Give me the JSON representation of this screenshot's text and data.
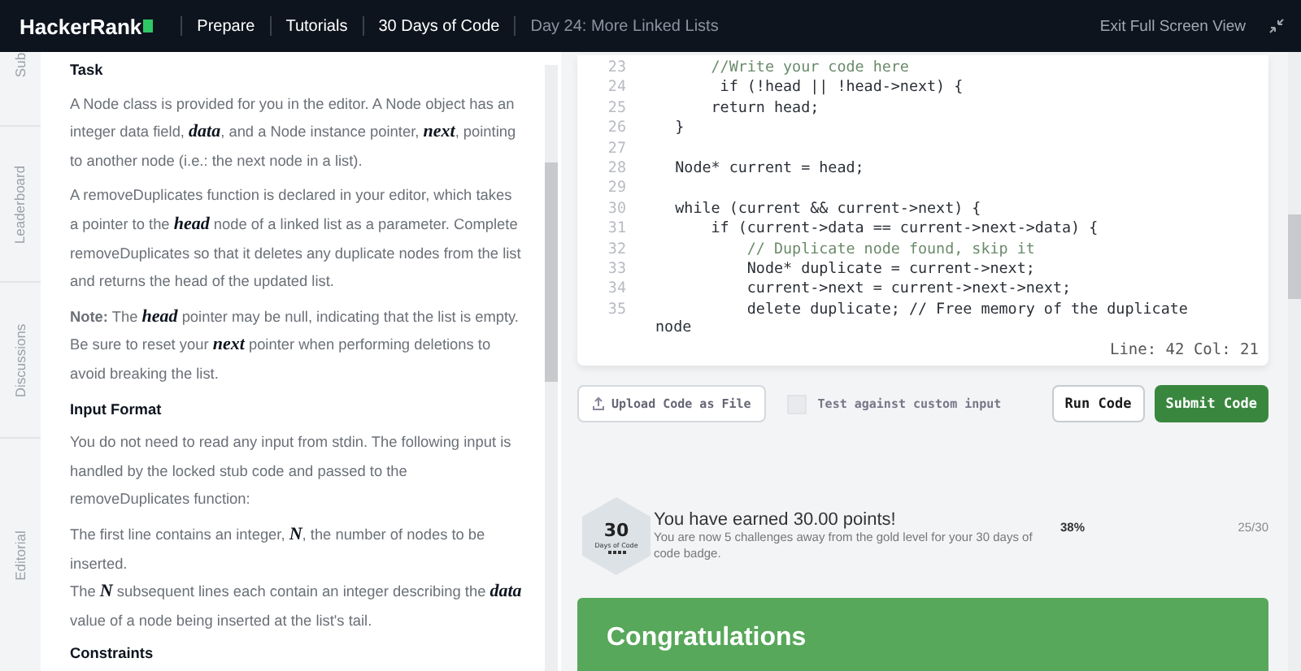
{
  "header": {
    "logo": "HackerRank",
    "breadcrumbs": [
      {
        "label": "Prepare",
        "current": false
      },
      {
        "label": "Tutorials",
        "current": false
      },
      {
        "label": "30 Days of Code",
        "current": false
      },
      {
        "label": "Day 24: More Linked Lists",
        "current": true
      }
    ],
    "exit_link": "Exit Full Screen View"
  },
  "side_tabs": [
    {
      "label": "Sub",
      "selected": false
    },
    {
      "label": "Leaderboard",
      "selected": false
    },
    {
      "label": "Discussions",
      "selected": false
    },
    {
      "label": "Editorial",
      "selected": false
    }
  ],
  "problem": [
    {
      "kind": "heading",
      "text": "Task"
    },
    {
      "kind": "para",
      "text": "A Node class is provided for you in the editor. A Node object has an integer data field, *data*, and a Node instance pointer, *next*, pointing to another node (i.e.: the next node in a list)."
    },
    {
      "kind": "para",
      "text": "A removeDuplicates function is declared in your editor, which takes a pointer to the *head* node of a linked list as a parameter. Complete removeDuplicates so that it deletes any duplicate nodes from the list and returns the head of the updated list."
    },
    {
      "kind": "para",
      "text": "**Note:** The *head* pointer may be null, indicating that the list is empty. Be sure to reset your *next* pointer when performing deletions to avoid breaking the list."
    },
    {
      "kind": "heading",
      "text": "Input Format"
    },
    {
      "kind": "para",
      "text": "You do not need to read any input from stdin. The following input is handled by the locked stub code and passed to the removeDuplicates function:"
    },
    {
      "kind": "line",
      "text": "The first line contains an integer, *N*, the number of nodes to be inserted."
    },
    {
      "kind": "line",
      "text": "The *N* subsequent lines each contain an integer describing the *data* value of a node being inserted at the list's tail."
    },
    {
      "kind": "heading",
      "text": "Constraints"
    }
  ],
  "editor": {
    "lines": [
      {
        "num": "23",
        "kind": "comment",
        "text": "        //Write your code here"
      },
      {
        "num": "24",
        "kind": "code",
        "text": "         if (!head || !head->next) {"
      },
      {
        "num": "25",
        "kind": "code",
        "text": "        return head;"
      },
      {
        "num": "26",
        "kind": "code",
        "text": "    }"
      },
      {
        "num": "27"
      },
      {
        "num": "28",
        "kind": "code",
        "text": "    Node* current = head;"
      },
      {
        "num": "29"
      },
      {
        "num": "30",
        "kind": "code",
        "text": "    while (current && current->next) {"
      },
      {
        "num": "31",
        "kind": "code",
        "text": "        if (current->data == current->next->data) {"
      },
      {
        "num": "32",
        "kind": "comment",
        "text": "            // Duplicate node found, skip it"
      },
      {
        "num": "33",
        "kind": "code",
        "text": "            Node* duplicate = current->next;"
      },
      {
        "num": "34",
        "kind": "code",
        "text": "            current->next = current->next->next;"
      },
      {
        "num": "35",
        "kind": "code",
        "text": "            delete duplicate; // Free memory of the duplicate"
      }
    ],
    "wrap": "node",
    "status": "Line: 42 Col: 21"
  },
  "actions": {
    "upload": "Upload Code as File",
    "custom_input": {
      "label": "Test against custom input",
      "checked": false
    },
    "run": "Run Code",
    "submit": "Submit Code"
  },
  "badge": {
    "number": "30",
    "label": "Days of Code",
    "stars": 4
  },
  "points": {
    "title": "You have earned 30.00 points!",
    "text": "You are now 5 challenges away from the gold level for your 30 days of code badge.",
    "percent": "38%",
    "progress": "25/30"
  },
  "banner": {
    "title": "Congratulations"
  }
}
